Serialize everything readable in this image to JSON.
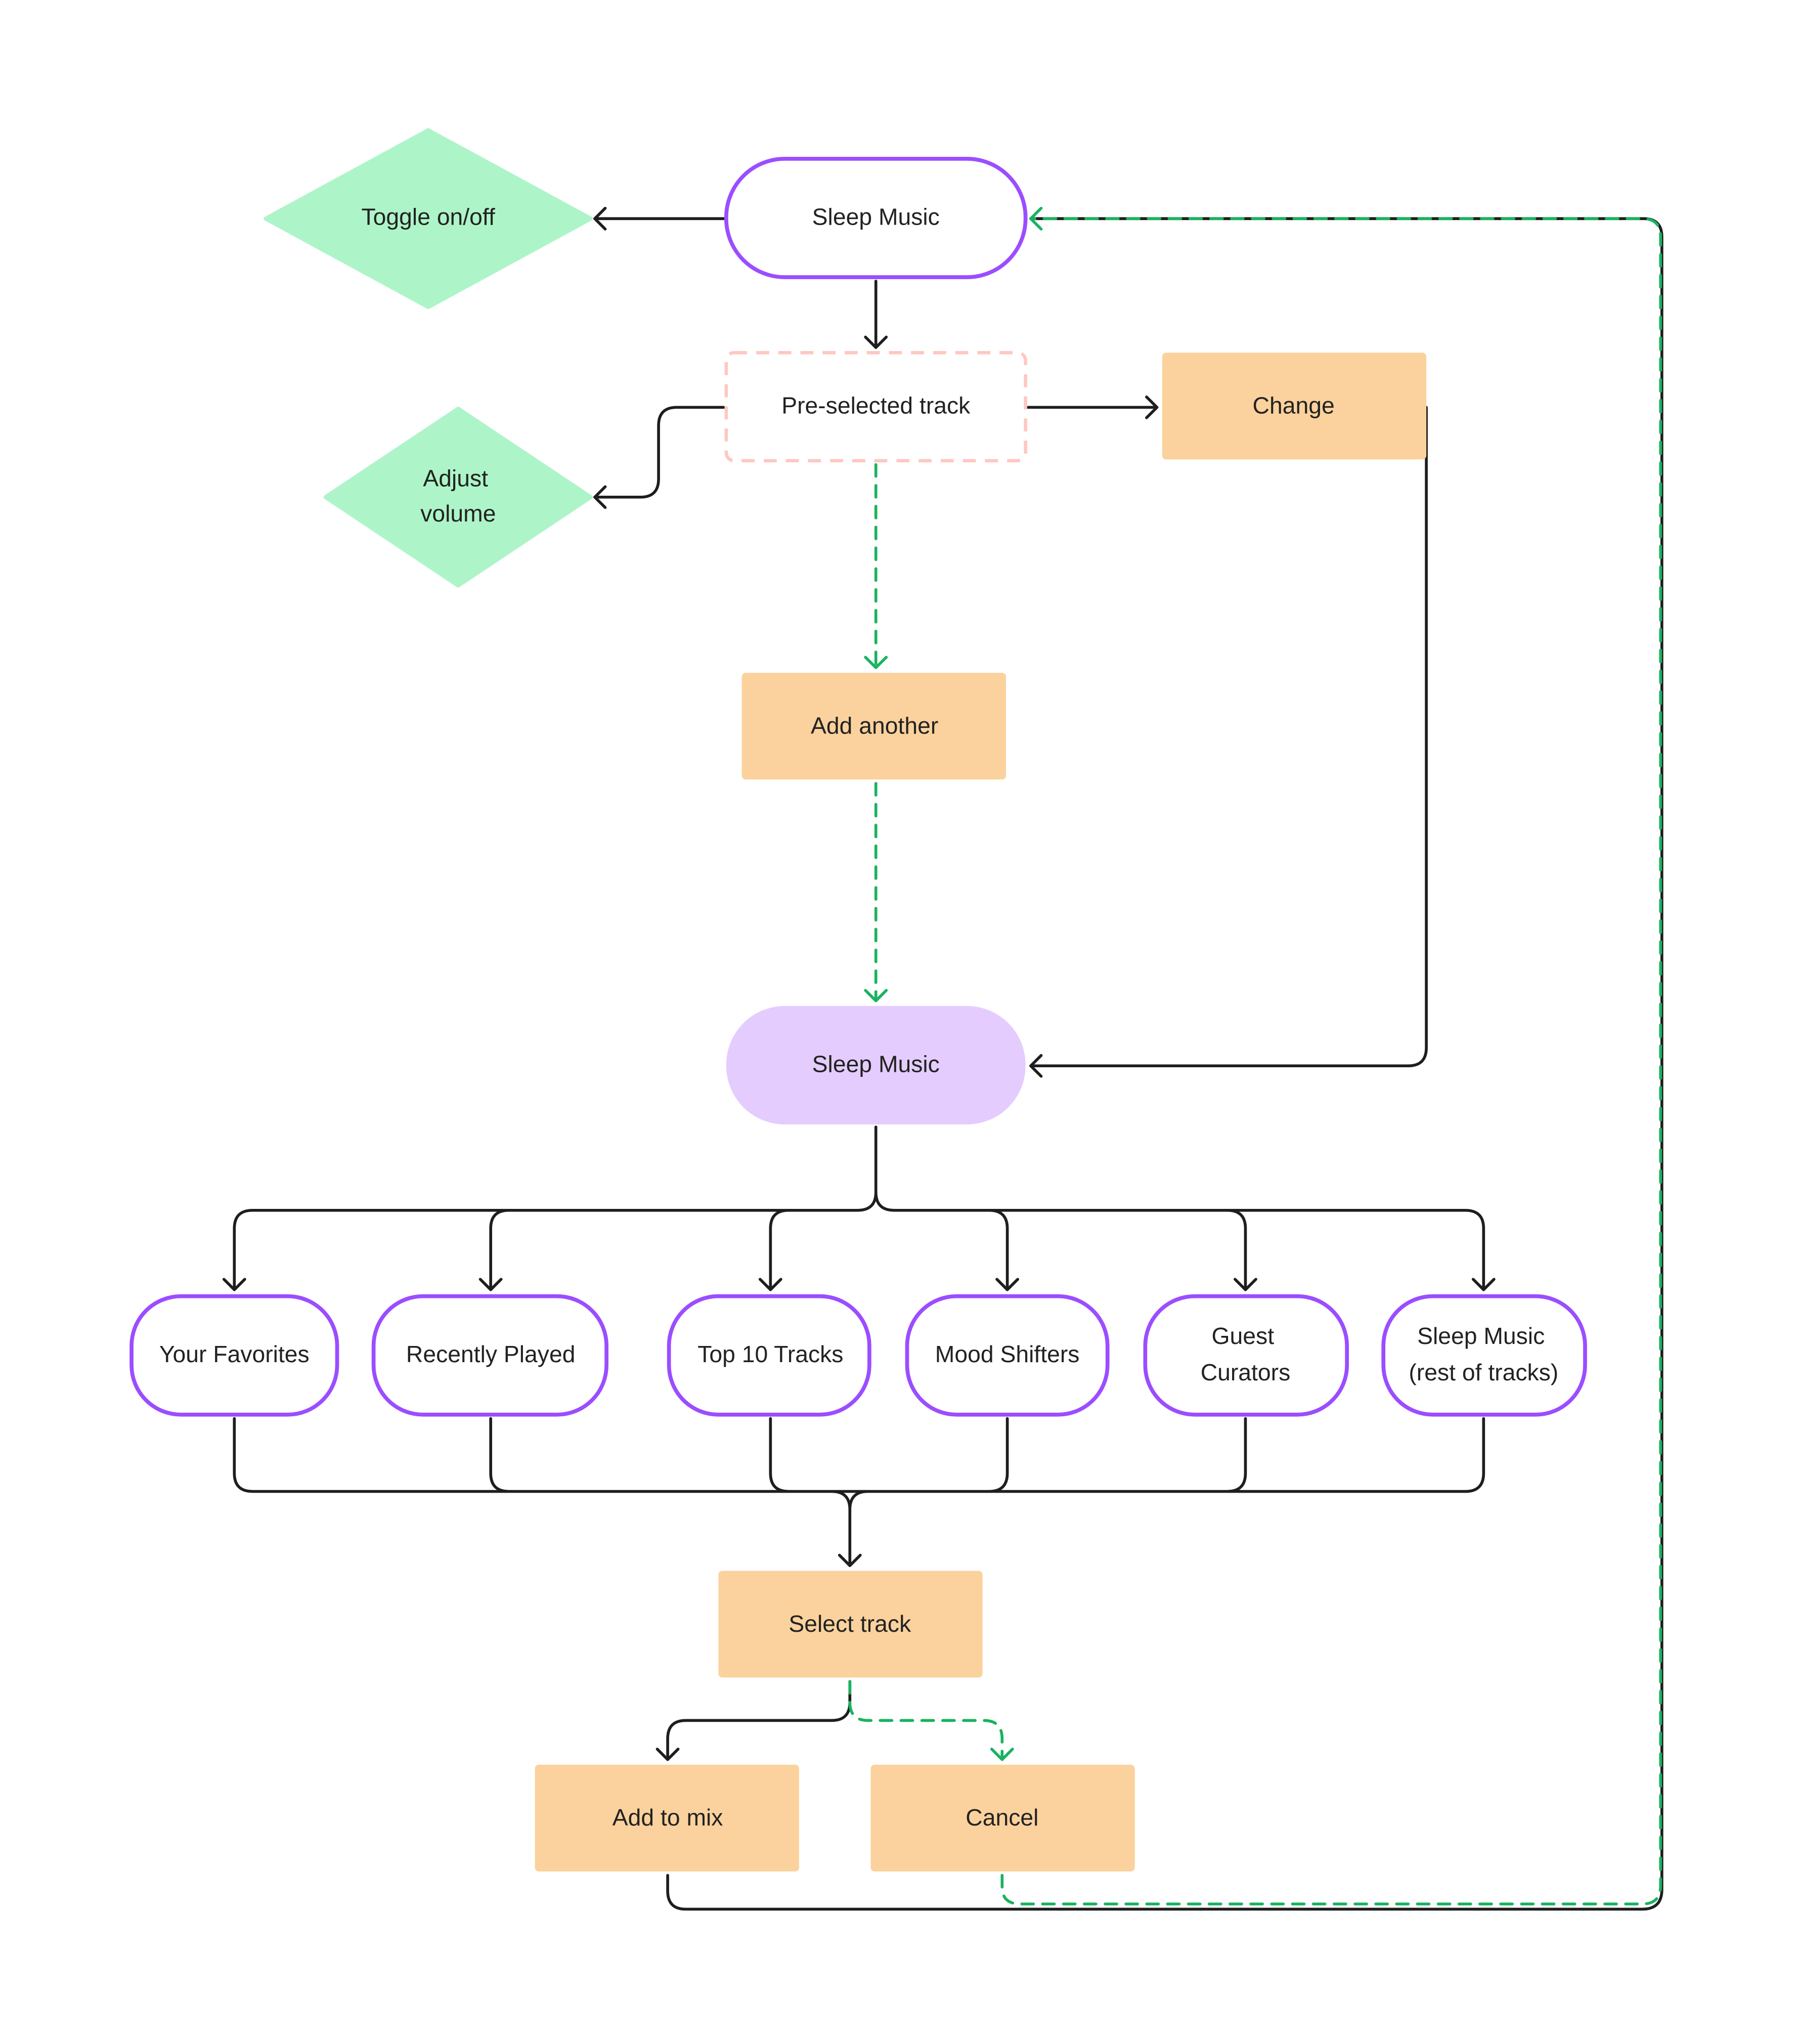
{
  "colors": {
    "terminal_stroke": "#9B4DFF",
    "terminal_fill_active": "#E4CCFF",
    "process_fill": "#FBD29D",
    "decision_fill": "#ADF5C8",
    "dashed_box_stroke": "#FFC7C0",
    "edge": "#1E1E1E",
    "alt_edge": "#19B35F"
  },
  "nodes": {
    "toggle": {
      "label": "Toggle on/off",
      "shape": "diamond"
    },
    "sleep_music_top": {
      "label": "Sleep Music",
      "shape": "terminal"
    },
    "preselected": {
      "label": "Pre-selected track",
      "shape": "dashed-rect"
    },
    "change": {
      "label": "Change",
      "shape": "rect"
    },
    "adjust_volume": {
      "lines": [
        "Adjust",
        "volume"
      ],
      "shape": "diamond"
    },
    "add_another": {
      "label": "Add another",
      "shape": "rect"
    },
    "sleep_music_mid": {
      "label": "Sleep Music",
      "shape": "terminal-filled"
    },
    "categories": [
      {
        "lines": [
          "Your Favorites"
        ]
      },
      {
        "lines": [
          "Recently Played"
        ]
      },
      {
        "lines": [
          "Top 10 Tracks"
        ]
      },
      {
        "lines": [
          "Mood Shifters"
        ]
      },
      {
        "lines": [
          "Guest",
          "Curators"
        ]
      },
      {
        "lines": [
          "Sleep Music",
          "(rest of tracks)"
        ]
      }
    ],
    "select_track": {
      "label": "Select track",
      "shape": "rect"
    },
    "add_to_mix": {
      "label": "Add to mix",
      "shape": "rect"
    },
    "cancel": {
      "label": "Cancel",
      "shape": "rect"
    }
  }
}
